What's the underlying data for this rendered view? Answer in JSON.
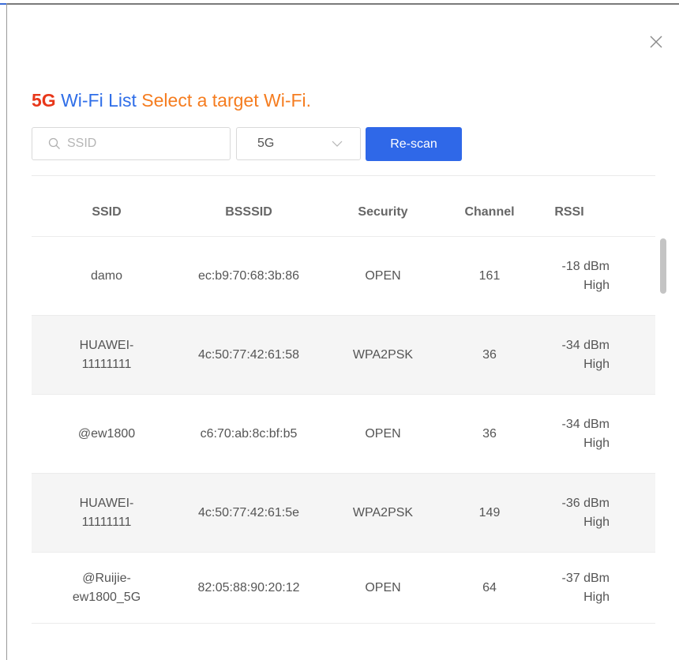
{
  "title": {
    "band": "5G",
    "list": "Wi-Fi List",
    "hint": "Select a target Wi-Fi."
  },
  "search": {
    "placeholder": "SSID",
    "value": ""
  },
  "band_select": {
    "value": "5G"
  },
  "rescan_label": "Re-scan",
  "columns": [
    "SSID",
    "BSSSID",
    "Security",
    "Channel",
    "RSSI"
  ],
  "rows": [
    {
      "ssid_1": "damo",
      "ssid_2": "",
      "bssid": "ec:b9:70:68:3b:86",
      "security": "OPEN",
      "channel": "161",
      "rssi": "-18 dBm",
      "level": "High"
    },
    {
      "ssid_1": "HUAWEI-",
      "ssid_2": "11111111",
      "bssid": "4c:50:77:42:61:58",
      "security": "WPA2PSK",
      "channel": "36",
      "rssi": "-34 dBm",
      "level": "High"
    },
    {
      "ssid_1": "@ew1800",
      "ssid_2": "",
      "bssid": "c6:70:ab:8c:bf:b5",
      "security": "OPEN",
      "channel": "36",
      "rssi": "-34 dBm",
      "level": "High"
    },
    {
      "ssid_1": "HUAWEI-",
      "ssid_2": "11111111",
      "bssid": "4c:50:77:42:61:5e",
      "security": "WPA2PSK",
      "channel": "149",
      "rssi": "-36 dBm",
      "level": "High"
    },
    {
      "ssid_1": "@Ruijie-",
      "ssid_2": "ew1800_5G",
      "bssid": "82:05:88:90:20:12",
      "security": "OPEN",
      "channel": "64",
      "rssi": "-37 dBm",
      "level": "High"
    }
  ],
  "colors": {
    "band": "#e8371a",
    "list": "#2f6ee8",
    "hint": "#f57c1f",
    "button": "#2f68e8",
    "alt_row": "#f5f5f5"
  },
  "icons": [
    "close-icon",
    "search-icon",
    "chevron-down-icon"
  ]
}
